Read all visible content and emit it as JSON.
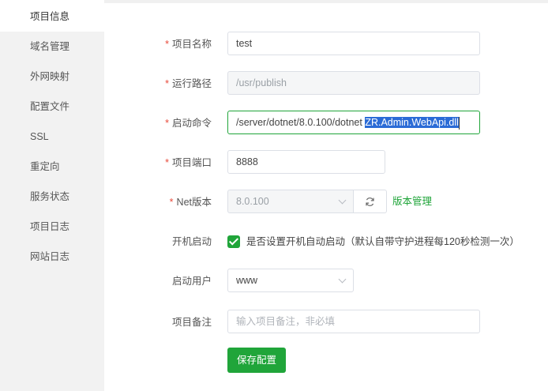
{
  "sidebar": {
    "items": [
      {
        "label": "项目信息"
      },
      {
        "label": "域名管理"
      },
      {
        "label": "外网映射"
      },
      {
        "label": "配置文件"
      },
      {
        "label": "SSL"
      },
      {
        "label": "重定向"
      },
      {
        "label": "服务状态"
      },
      {
        "label": "项目日志"
      },
      {
        "label": "网站日志"
      }
    ],
    "active_index": 0
  },
  "form": {
    "required_mark": "*",
    "project_name": {
      "label": "项目名称",
      "value": "test"
    },
    "run_path": {
      "label": "运行路径",
      "value": "/usr/publish"
    },
    "start_command": {
      "label": "启动命令",
      "value_plain": "/server/dotnet/8.0.100/dotnet ",
      "value_selected": "ZR.Admin.WebApi.dll"
    },
    "project_port": {
      "label": "项目端口",
      "value": "8888"
    },
    "net_version": {
      "label": "Net版本",
      "value": "8.0.100",
      "version_manage_link": "版本管理",
      "refresh_icon": "refresh-icon"
    },
    "autostart": {
      "label": "开机启动",
      "checked": true,
      "text": "是否设置开机自动启动（默认自带守护进程每120秒检测一次）"
    },
    "start_user": {
      "label": "启动用户",
      "value": "www"
    },
    "project_remark": {
      "label": "项目备注",
      "placeholder": "输入项目备注，非必填"
    },
    "save_label": "保存配置"
  },
  "colors": {
    "accent": "#20a53a",
    "required": "#e84a3a",
    "selection": "#2b6bd6",
    "sidebar_bg": "#f2f2f2"
  }
}
